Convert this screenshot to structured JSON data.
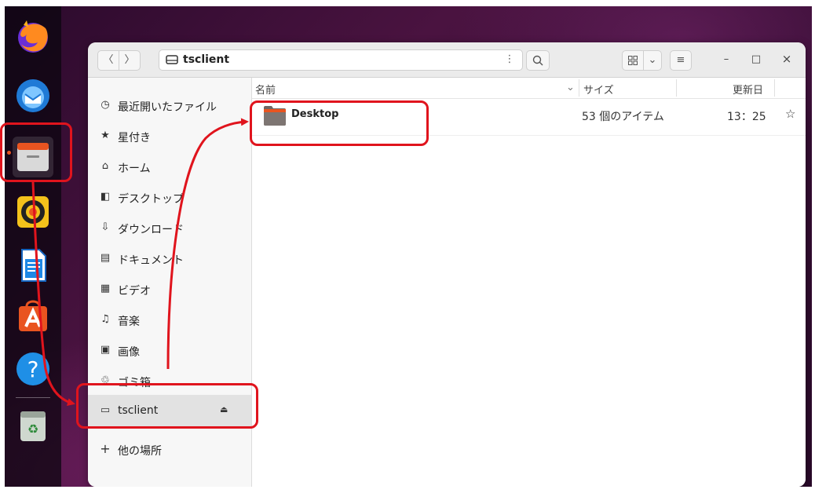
{
  "colors": {
    "accent": "#e95420",
    "highlight": "#e0141d",
    "sidebar_bg": "#f7f7f7"
  },
  "dock": {
    "apps": [
      {
        "name": "firefox-icon"
      },
      {
        "name": "thunderbird-icon"
      },
      {
        "name": "files-icon",
        "running": true
      },
      {
        "name": "rhythmbox-icon"
      },
      {
        "name": "libreoffice-writer-icon"
      },
      {
        "name": "ubuntu-software-icon"
      },
      {
        "name": "help-icon"
      },
      {
        "name": "trash-icon"
      }
    ]
  },
  "headerbar": {
    "back_icon": "〈",
    "forward_icon": "〉",
    "location": "tsclient",
    "menu_icon": "⋮",
    "search_icon": "search-icon",
    "view_icon": "grid-view-icon",
    "dropdown_icon": "⌄",
    "hamburger_icon": "≡",
    "minimize": "–",
    "maximize": "□",
    "close": "×"
  },
  "sidebar": {
    "items": [
      {
        "icon": "◷",
        "label": "最近開いたファイル"
      },
      {
        "icon": "★",
        "label": "星付き"
      },
      {
        "icon": "⌂",
        "label": "ホーム"
      },
      {
        "icon": "◧",
        "label": "デスクトップ"
      },
      {
        "icon": "⇩",
        "label": "ダウンロード"
      },
      {
        "icon": "▤",
        "label": "ドキュメント"
      },
      {
        "icon": "▦",
        "label": "ビデオ"
      },
      {
        "icon": "♫",
        "label": "音楽"
      },
      {
        "icon": "▣",
        "label": "画像"
      },
      {
        "icon": "♲",
        "label": "ゴミ箱"
      },
      {
        "icon": "▭",
        "label": "tsclient",
        "eject": "⏏"
      },
      {
        "icon": "+",
        "label": "他の場所"
      }
    ]
  },
  "content": {
    "columns": {
      "name": "名前",
      "sort_icon": "⌄",
      "size": "サイズ",
      "modified": "更新日"
    },
    "rows": [
      {
        "name": "Desktop",
        "size": "53 個のアイテム",
        "modified": "13：25",
        "star": "☆"
      }
    ]
  }
}
